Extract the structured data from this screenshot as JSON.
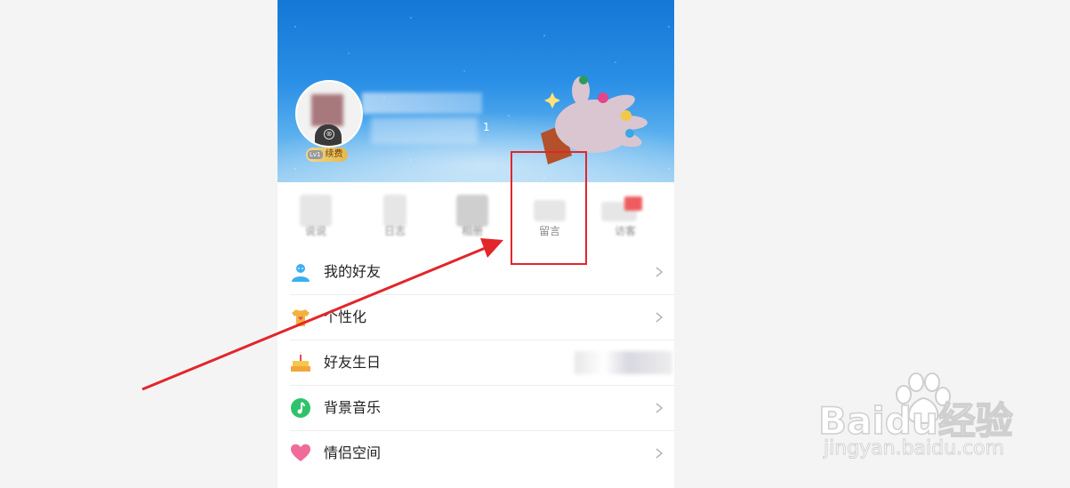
{
  "profile": {
    "level_label": "Lv1",
    "renew_label": "续费",
    "level_number": "1"
  },
  "quick_nav": {
    "items": [
      {
        "label": "说说"
      },
      {
        "label": "日志"
      },
      {
        "label": "相册"
      },
      {
        "label": "留言"
      },
      {
        "label": "访客"
      }
    ]
  },
  "menu": {
    "items": [
      {
        "label": "我的好友",
        "icon": "friends-icon",
        "color": "#3ab0f0"
      },
      {
        "label": "个性化",
        "icon": "tshirt-icon",
        "color": "#f3b23b"
      },
      {
        "label": "好友生日",
        "icon": "cake-icon",
        "color": "#f2a63a"
      },
      {
        "label": "背景音乐",
        "icon": "music-icon",
        "color": "#2fc26b"
      },
      {
        "label": "情侣空间",
        "icon": "heart-icon",
        "color": "#f06b9a"
      }
    ]
  },
  "annotation": {
    "highlight_color": "#e2262a"
  },
  "watermark": {
    "brand": "Bai",
    "brand_mid": "du",
    "brand_cn": "经验",
    "url": "jingyan.baidu.com"
  }
}
